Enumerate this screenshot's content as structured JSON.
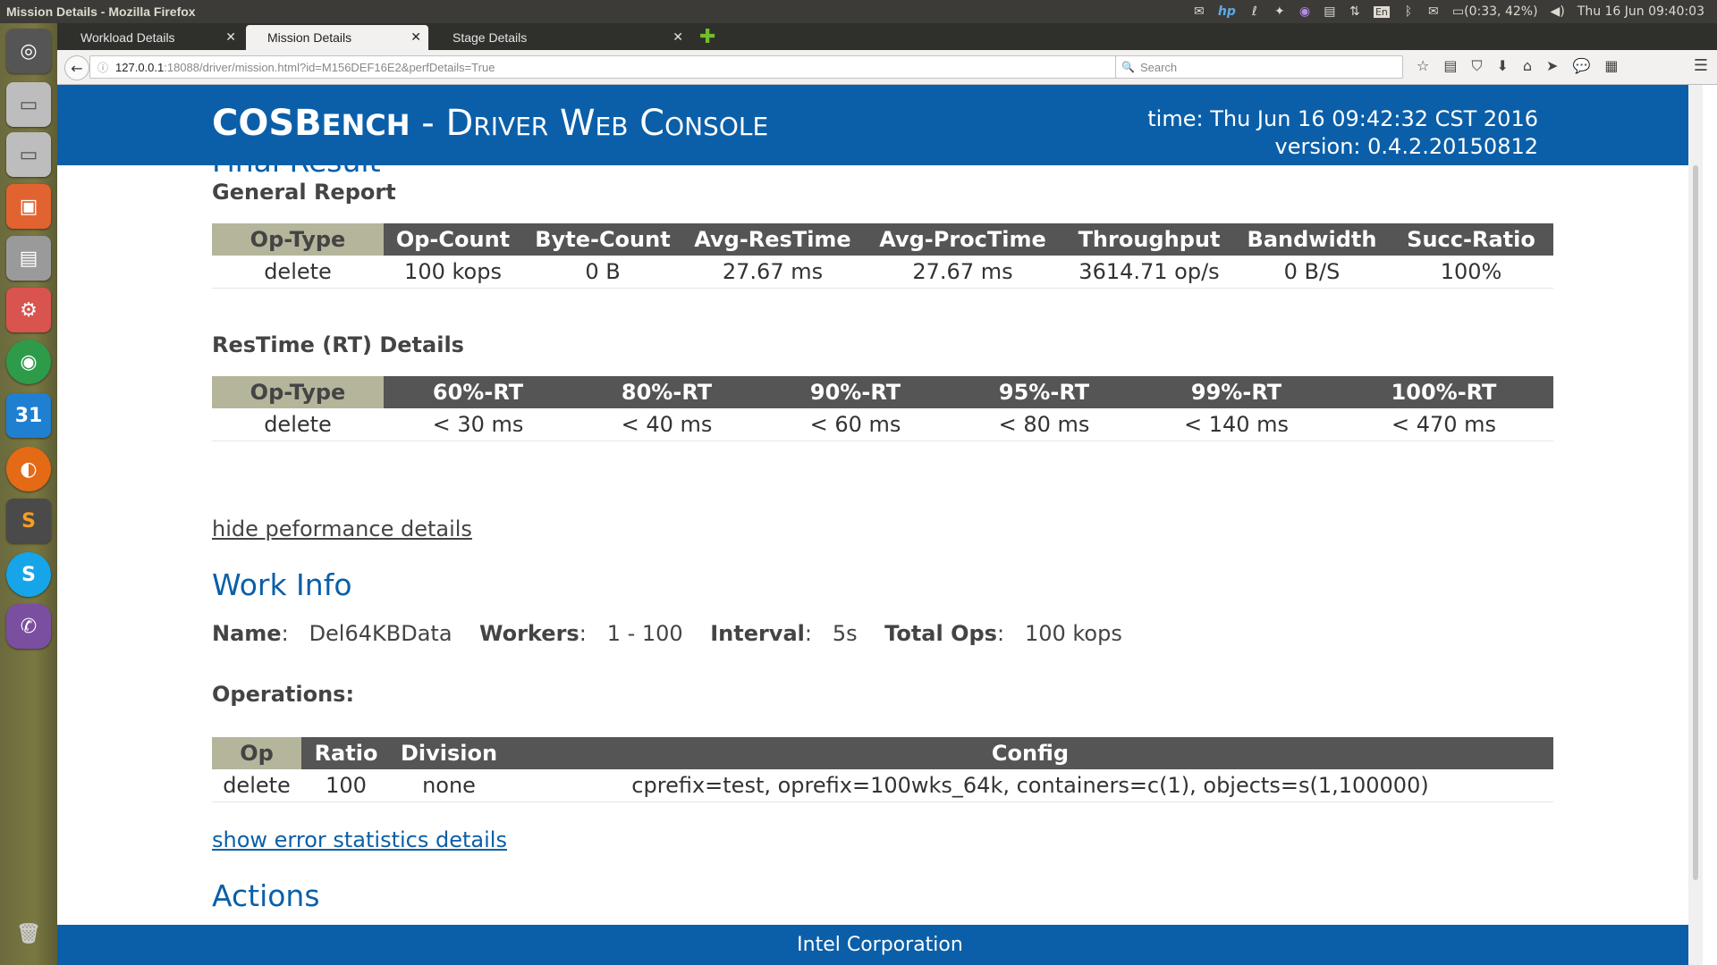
{
  "window": {
    "title": "Mission Details - Mozilla Firefox"
  },
  "tray": {
    "battery": "(0:33, 42%)",
    "datetime": "Thu 16 Jun 09:40:03",
    "lang": "En"
  },
  "launcher": {
    "calendar_day": "31"
  },
  "tabs": [
    {
      "label": "Workload Details"
    },
    {
      "label": "Mission Details"
    },
    {
      "label": "Stage Details"
    }
  ],
  "nav": {
    "url_host": "127.0.0.1",
    "url_rest": ":18088/driver/mission.html?id=M156DEF16E2&perfDetails=True",
    "search_placeholder": "Search"
  },
  "header": {
    "brand_main": "COSB",
    "brand_ench": "ENCH",
    "brand_sep": " - ",
    "brand_sub": "Driver Web Console",
    "time": "time: Thu Jun 16 09:42:32 CST 2016",
    "version": "version: 0.4.2.20150812"
  },
  "final_result": {
    "title": "Final Result"
  },
  "general_report": {
    "title": "General Report",
    "columns": [
      "Op-Type",
      "Op-Count",
      "Byte-Count",
      "Avg-ResTime",
      "Avg-ProcTime",
      "Throughput",
      "Bandwidth",
      "Succ-Ratio"
    ],
    "rows": [
      [
        "delete",
        "100 kops",
        "0 B",
        "27.67 ms",
        "27.67 ms",
        "3614.71 op/s",
        "0 B/S",
        "100%"
      ]
    ]
  },
  "restime": {
    "title": "ResTime (RT) Details",
    "columns": [
      "Op-Type",
      "60%-RT",
      "80%-RT",
      "90%-RT",
      "95%-RT",
      "99%-RT",
      "100%-RT"
    ],
    "rows": [
      [
        "delete",
        "< 30 ms",
        "< 40 ms",
        "< 60 ms",
        "< 80 ms",
        "< 140 ms",
        "< 470 ms"
      ]
    ]
  },
  "hide_perf_link": "hide peformance details",
  "work_info": {
    "title": "Work Info",
    "name_label": "Name",
    "name_value": "Del64KBData",
    "workers_label": "Workers",
    "workers_value": "1 - 100",
    "interval_label": "Interval",
    "interval_value": "5s",
    "totalops_label": "Total Ops",
    "totalops_value": "100 kops",
    "sep": ":"
  },
  "operations": {
    "title": "Operations:",
    "columns": [
      "Op",
      "Ratio",
      "Division",
      "Config"
    ],
    "rows": [
      [
        "delete",
        "100",
        "none",
        "cprefix=test, oprefix=100wks_64k, containers=c(1), objects=s(1,100000)"
      ]
    ]
  },
  "error_link": "show error statistics details",
  "actions": {
    "title": "Actions"
  },
  "footer": {
    "text": "Intel Corporation"
  }
}
